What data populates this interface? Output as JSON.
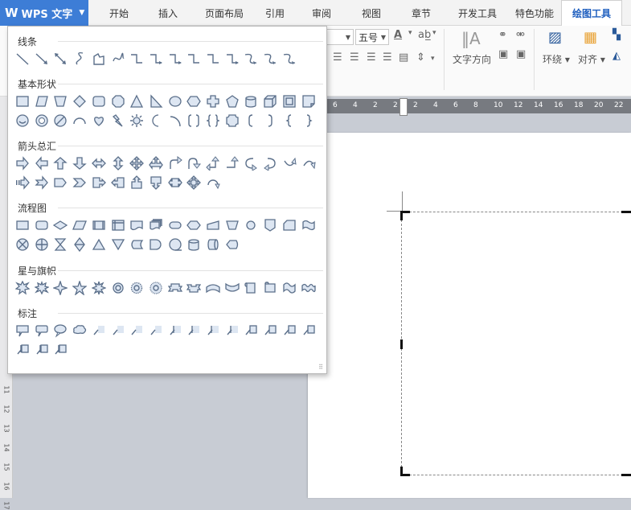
{
  "app": {
    "name": "WPS 文字",
    "logo": "W"
  },
  "tabs": [
    {
      "label": "开始",
      "active": false
    },
    {
      "label": "插入",
      "active": false
    },
    {
      "label": "页面布局",
      "active": false
    },
    {
      "label": "引用",
      "active": false
    },
    {
      "label": "审阅",
      "active": false
    },
    {
      "label": "视图",
      "active": false
    },
    {
      "label": "章节",
      "active": false
    },
    {
      "label": "开发工具",
      "active": false
    },
    {
      "label": "特色功能",
      "active": false
    },
    {
      "label": "绘图工具",
      "active": true
    }
  ],
  "ribbon": {
    "font_size": "五号",
    "text_direction_label": "文字方向",
    "wrap_label": "环绕",
    "align_label": "对齐"
  },
  "shapes_panel": {
    "categories": [
      {
        "title": "线条",
        "shapes": [
          "line",
          "arrow-line",
          "double-arrow-line",
          "curve",
          "freeform",
          "scribble",
          "elbow-connector",
          "elbow-arrow-connector",
          "elbow-double-arrow-connector",
          "straight-connector",
          "elbow-connector-2",
          "elbow-double-arrow",
          "curved-connector",
          "curved-arrow-connector",
          "curved-double-arrow-connector"
        ]
      },
      {
        "title": "基本形状",
        "shapes": [
          "rectangle",
          "parallelogram",
          "trapezoid",
          "diamond",
          "rounded-rectangle",
          "octagon",
          "triangle",
          "right-triangle",
          "ellipse",
          "hexagon",
          "cross",
          "pentagon",
          "can",
          "cube",
          "bevel",
          "folded-corner",
          "smiley",
          "donut",
          "no-symbol",
          "block-arc",
          "heart",
          "lightning",
          "sun",
          "moon",
          "arc",
          "double-bracket",
          "double-brace",
          "plaque",
          "left-bracket",
          "right-bracket",
          "left-brace",
          "right-brace"
        ]
      },
      {
        "title": "箭头总汇",
        "shapes": [
          "right-arrow",
          "left-arrow",
          "up-arrow",
          "down-arrow",
          "left-right-arrow",
          "up-down-arrow",
          "quad-arrow",
          "left-right-up-arrow",
          "bent-arrow",
          "u-turn-arrow",
          "left-up-arrow",
          "bent-up-arrow",
          "curved-right-arrow",
          "curved-left-arrow",
          "curved-up-arrow",
          "curved-down-arrow",
          "striped-right-arrow",
          "notched-right-arrow",
          "pentagon-arrow",
          "chevron",
          "right-arrow-callout",
          "left-arrow-callout",
          "up-arrow-callout",
          "down-arrow-callout",
          "left-right-arrow-callout",
          "quad-arrow-callout",
          "circular-arrow"
        ]
      },
      {
        "title": "流程图",
        "shapes": [
          "process",
          "alternate-process",
          "decision",
          "data",
          "predefined-process",
          "internal-storage",
          "document",
          "multidocument",
          "terminator",
          "preparation",
          "manual-input",
          "manual-operation",
          "connector",
          "off-page-connector",
          "card",
          "punched-tape",
          "summing-junction",
          "or",
          "collate",
          "sort",
          "extract",
          "merge",
          "stored-data",
          "delay",
          "sequential-access",
          "magnetic-disk",
          "direct-access",
          "display"
        ]
      },
      {
        "title": "星与旗帜",
        "shapes": [
          "explosion-1",
          "explosion-2",
          "4-point-star",
          "5-point-star",
          "8-point-star",
          "16-point-star",
          "24-point-star",
          "32-point-star",
          "up-ribbon",
          "down-ribbon",
          "curved-up-ribbon",
          "curved-down-ribbon",
          "vertical-scroll",
          "horizontal-scroll",
          "wave",
          "double-wave"
        ]
      },
      {
        "title": "标注",
        "shapes": [
          "rect-callout",
          "rounded-callout",
          "oval-callout",
          "cloud-callout",
          "line-callout-1",
          "line-callout-2",
          "line-callout-3",
          "line-callout-4",
          "accent-callout-1",
          "accent-callout-2",
          "accent-callout-3",
          "accent-callout-4",
          "border-callout-1",
          "border-callout-2",
          "border-callout-3",
          "border-callout-4",
          "accent-border-callout-1",
          "accent-border-callout-2",
          "accent-border-callout-3"
        ]
      }
    ]
  },
  "hruler_ticks": [
    "6",
    "4",
    "2",
    "2",
    "2",
    "4",
    "6",
    "8",
    "10",
    "12",
    "14",
    "16",
    "18",
    "20",
    "22"
  ],
  "vruler_ticks": [
    "11",
    "12",
    "13",
    "14",
    "15",
    "16",
    "17"
  ],
  "colors": {
    "accent": "#3d7dd6",
    "active_tab_text": "#1f5fbf",
    "shape_stroke": "#5b6f8a",
    "shape_fill": "#dde6f2"
  }
}
